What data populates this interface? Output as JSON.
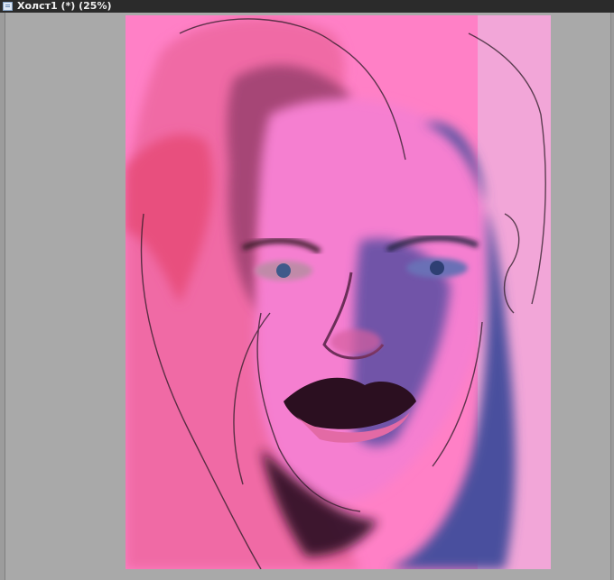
{
  "window": {
    "title": "Холст1 (*) (25%)"
  },
  "canvas": {
    "background_color": "#ff80c6",
    "workspace_color": "#a9a9a9"
  },
  "icons": {
    "document": "document-icon"
  }
}
